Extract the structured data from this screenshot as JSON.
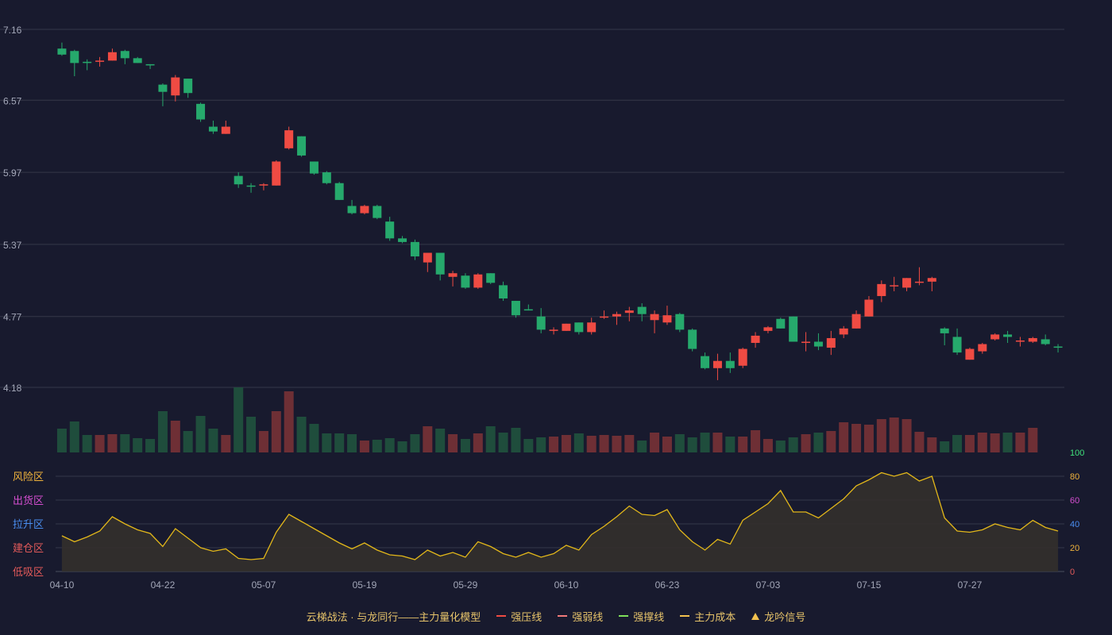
{
  "colors": {
    "background": "#181a2e",
    "grid": "#353849",
    "up": "#ef4b43",
    "down": "#26a96c",
    "up_volume": "#6e2f35",
    "down_volume": "#1f4d3c",
    "indicator_line": "#e2b71a",
    "indicator_fill": "#33302c",
    "tick_text": "#a3a7b8"
  },
  "zones": [
    {
      "label": "风险区",
      "color": "#f0b33c"
    },
    {
      "label": "出货区",
      "color": "#d44ed0"
    },
    {
      "label": "拉升区",
      "color": "#4a8ef0"
    },
    {
      "label": "建仓区",
      "color": "#e35a5a"
    },
    {
      "label": "低吸区",
      "color": "#e35a5a"
    }
  ],
  "indicator_axis": [
    {
      "label": "100",
      "color": "#3fe07a"
    },
    {
      "label": "80",
      "color": "#f0b33c"
    },
    {
      "label": "60",
      "color": "#d44ed0"
    },
    {
      "label": "40",
      "color": "#4a8ef0"
    },
    {
      "label": "20",
      "color": "#f0b33c"
    },
    {
      "label": "0",
      "color": "#e35a5a"
    }
  ],
  "legend": {
    "title": "云梯战法 · 与龙同行——主力量化模型",
    "items": [
      {
        "label": "强压线",
        "color": "#ef4b43",
        "style": "solid"
      },
      {
        "label": "强弱线",
        "color": "#f07a7a",
        "style": "dashed"
      },
      {
        "label": "强撑线",
        "color": "#7ee05a",
        "style": "solid"
      },
      {
        "label": "主力成本",
        "color": "#f2c14e",
        "style": "dashed"
      },
      {
        "label": "龙吟信号",
        "color": "#f2c14e",
        "style": "triangle"
      }
    ]
  },
  "chart_data": {
    "type": "candlestick",
    "y_ticks": [
      "7.16",
      "6.57",
      "5.97",
      "5.37",
      "4.77",
      "4.18"
    ],
    "ylim": [
      4.18,
      7.16
    ],
    "x_ticks": [
      "04-10",
      "04-22",
      "05-07",
      "05-19",
      "05-29",
      "06-10",
      "06-23",
      "07-03",
      "07-15",
      "07-27"
    ],
    "x_tick_index": [
      0,
      8,
      16,
      24,
      32,
      40,
      48,
      56,
      64,
      72
    ],
    "candles": [
      [
        7.0,
        6.95,
        7.05,
        6.94
      ],
      [
        6.98,
        6.88,
        6.99,
        6.77
      ],
      [
        6.89,
        6.88,
        6.91,
        6.82
      ],
      [
        6.89,
        6.9,
        6.93,
        6.85
      ],
      [
        6.9,
        6.97,
        7.0,
        6.9
      ],
      [
        6.98,
        6.92,
        6.99,
        6.87
      ],
      [
        6.92,
        6.88,
        6.93,
        6.88
      ],
      [
        6.87,
        6.86,
        6.87,
        6.83
      ],
      [
        6.7,
        6.64,
        6.71,
        6.52
      ],
      [
        6.61,
        6.76,
        6.78,
        6.56
      ],
      [
        6.75,
        6.63,
        6.75,
        6.59
      ],
      [
        6.54,
        6.41,
        6.55,
        6.39
      ],
      [
        6.35,
        6.31,
        6.4,
        6.29
      ],
      [
        6.29,
        6.35,
        6.4,
        6.29
      ],
      [
        5.94,
        5.87,
        5.97,
        5.84
      ],
      [
        5.86,
        5.85,
        5.88,
        5.8
      ],
      [
        5.86,
        5.87,
        5.88,
        5.82
      ],
      [
        5.86,
        6.06,
        6.07,
        5.86
      ],
      [
        6.17,
        6.32,
        6.35,
        6.16
      ],
      [
        6.27,
        6.11,
        6.27,
        6.1
      ],
      [
        6.06,
        5.96,
        6.06,
        5.95
      ],
      [
        5.97,
        5.88,
        5.98,
        5.87
      ],
      [
        5.88,
        5.74,
        5.89,
        5.74
      ],
      [
        5.69,
        5.63,
        5.74,
        5.62
      ],
      [
        5.63,
        5.69,
        5.7,
        5.62
      ],
      [
        5.69,
        5.59,
        5.7,
        5.58
      ],
      [
        5.56,
        5.42,
        5.6,
        5.4
      ],
      [
        5.42,
        5.39,
        5.44,
        5.38
      ],
      [
        5.39,
        5.27,
        5.41,
        5.24
      ],
      [
        5.22,
        5.3,
        5.3,
        5.14
      ],
      [
        5.3,
        5.12,
        5.3,
        5.07
      ],
      [
        5.1,
        5.13,
        5.15,
        5.02
      ],
      [
        5.11,
        5.01,
        5.13,
        5.0
      ],
      [
        5.01,
        5.12,
        5.13,
        5.0
      ],
      [
        5.13,
        5.05,
        5.13,
        5.04
      ],
      [
        5.03,
        4.92,
        5.06,
        4.9
      ],
      [
        4.9,
        4.78,
        4.9,
        4.76
      ],
      [
        4.83,
        4.82,
        4.87,
        4.82
      ],
      [
        4.77,
        4.66,
        4.84,
        4.63
      ],
      [
        4.65,
        4.66,
        4.68,
        4.62
      ],
      [
        4.65,
        4.71,
        4.71,
        4.65
      ],
      [
        4.72,
        4.64,
        4.72,
        4.62
      ],
      [
        4.64,
        4.72,
        4.76,
        4.62
      ],
      [
        4.76,
        4.77,
        4.82,
        4.75
      ],
      [
        4.77,
        4.79,
        4.81,
        4.7
      ],
      [
        4.8,
        4.82,
        4.85,
        4.73
      ],
      [
        4.85,
        4.79,
        4.88,
        4.73
      ],
      [
        4.74,
        4.79,
        4.82,
        4.63
      ],
      [
        4.72,
        4.78,
        4.86,
        4.7
      ],
      [
        4.79,
        4.66,
        4.8,
        4.64
      ],
      [
        4.66,
        4.5,
        4.67,
        4.48
      ],
      [
        4.44,
        4.34,
        4.47,
        4.33
      ],
      [
        4.34,
        4.4,
        4.46,
        4.24
      ],
      [
        4.4,
        4.34,
        4.47,
        4.3
      ],
      [
        4.36,
        4.5,
        4.51,
        4.34
      ],
      [
        4.55,
        4.61,
        4.64,
        4.51
      ],
      [
        4.65,
        4.68,
        4.69,
        4.63
      ],
      [
        4.75,
        4.67,
        4.76,
        4.67
      ],
      [
        4.77,
        4.56,
        4.77,
        4.56
      ],
      [
        4.55,
        4.56,
        4.64,
        4.48
      ],
      [
        4.56,
        4.52,
        4.63,
        4.49
      ],
      [
        4.51,
        4.59,
        4.65,
        4.45
      ],
      [
        4.62,
        4.67,
        4.69,
        4.59
      ],
      [
        4.67,
        4.79,
        4.82,
        4.67
      ],
      [
        4.77,
        4.91,
        4.94,
        4.77
      ],
      [
        4.94,
        5.04,
        5.07,
        4.89
      ],
      [
        5.03,
        5.03,
        5.1,
        4.98
      ],
      [
        5.01,
        5.09,
        5.09,
        4.98
      ],
      [
        5.06,
        5.06,
        5.18,
        5.03
      ],
      [
        5.06,
        5.09,
        5.1,
        4.98
      ],
      [
        4.67,
        4.63,
        4.68,
        4.53
      ],
      [
        4.6,
        4.47,
        4.67,
        4.45
      ],
      [
        4.41,
        4.5,
        4.51,
        4.41
      ],
      [
        4.48,
        4.54,
        4.55,
        4.46
      ],
      [
        4.58,
        4.62,
        4.63,
        4.57
      ],
      [
        4.62,
        4.6,
        4.65,
        4.55
      ],
      [
        4.56,
        4.57,
        4.6,
        4.52
      ],
      [
        4.56,
        4.59,
        4.6,
        4.55
      ],
      [
        4.58,
        4.54,
        4.62,
        4.53
      ],
      [
        4.52,
        4.51,
        4.54,
        4.47
      ]
    ],
    "volume": [
      30,
      39,
      22,
      22,
      23,
      23,
      18,
      17,
      52,
      40,
      27,
      46,
      30,
      22,
      82,
      45,
      27,
      52,
      77,
      45,
      36,
      24,
      24,
      23,
      15,
      16,
      18,
      14,
      23,
      33,
      30,
      23,
      17,
      24,
      33,
      25,
      31,
      17,
      19,
      20,
      22,
      24,
      21,
      22,
      21,
      22,
      15,
      25,
      20,
      23,
      19,
      25,
      25,
      20,
      20,
      28,
      17,
      15,
      19,
      23,
      25,
      27,
      38,
      36,
      35,
      42,
      44,
      42,
      26,
      19,
      14,
      22,
      22,
      25,
      24,
      25,
      25,
      31
    ],
    "volume_max": 82,
    "indicator": {
      "name": "",
      "values": [
        30,
        25,
        29,
        34,
        46,
        40,
        35,
        32,
        21,
        36,
        28,
        20,
        17,
        19,
        11,
        10,
        11,
        33,
        48,
        42,
        36,
        30,
        24,
        19,
        24,
        18,
        14,
        13,
        10,
        18,
        13,
        16,
        12,
        25,
        21,
        15,
        12,
        16,
        12,
        15,
        22,
        18,
        31,
        38,
        46,
        55,
        48,
        47,
        52,
        35,
        25,
        18,
        27,
        23,
        43,
        50,
        57,
        68,
        50,
        50,
        45,
        53,
        61,
        72,
        77,
        83,
        80,
        83,
        76,
        80,
        45,
        34,
        33,
        35,
        40,
        37,
        35,
        43,
        37,
        34
      ]
    }
  }
}
